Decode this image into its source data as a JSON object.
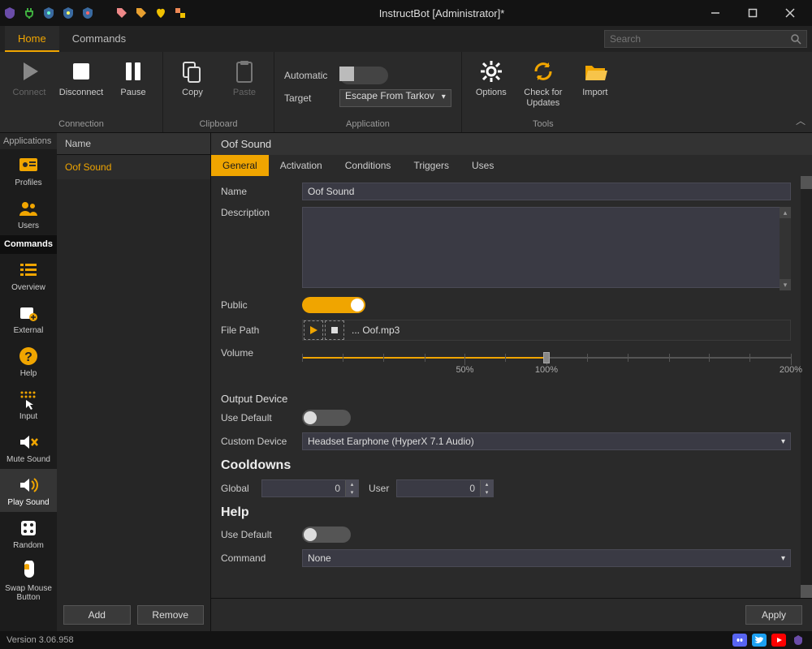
{
  "window": {
    "title": "InstructBot [Administrator]*"
  },
  "menu": {
    "tabs": [
      "Home",
      "Commands"
    ],
    "active": 0,
    "search_placeholder": "Search"
  },
  "ribbon": {
    "connection": {
      "label": "Connection",
      "connect": "Connect",
      "disconnect": "Disconnect",
      "pause": "Pause"
    },
    "clipboard": {
      "label": "Clipboard",
      "copy": "Copy",
      "paste": "Paste"
    },
    "application": {
      "label": "Application",
      "automatic_label": "Automatic",
      "target_label": "Target",
      "target_value": "Escape From Tarkov"
    },
    "tools": {
      "label": "Tools",
      "options": "Options",
      "check_updates": "Check for Updates",
      "import": "Import"
    }
  },
  "apps": {
    "header": "Applications",
    "items": [
      {
        "label": "Profiles"
      },
      {
        "label": "Users"
      },
      {
        "label": "Commands"
      },
      {
        "label": "Overview"
      },
      {
        "label": "External"
      },
      {
        "label": "Help"
      },
      {
        "label": "Input"
      },
      {
        "label": "Mute Sound"
      },
      {
        "label": "Play Sound"
      },
      {
        "label": "Random"
      },
      {
        "label": "Swap Mouse Button"
      }
    ],
    "active": 8
  },
  "list": {
    "column": "Name",
    "items": [
      "Oof Sound"
    ],
    "active": 0,
    "add": "Add",
    "remove": "Remove"
  },
  "editor": {
    "header": "Oof Sound",
    "tabs": [
      "General",
      "Activation",
      "Conditions",
      "Triggers",
      "Uses"
    ],
    "active": 0,
    "name_label": "Name",
    "name_value": "Oof Sound",
    "description_label": "Description",
    "description_value": "",
    "public_label": "Public",
    "public_on": true,
    "filepath_label": "File Path",
    "filepath_value": "...  Oof.mp3",
    "volume_label": "Volume",
    "volume_value": 100,
    "volume_ticks": [
      "50%",
      "100%",
      "200%"
    ],
    "output_device_heading": "Output Device",
    "use_default_label": "Use Default",
    "use_default_on": false,
    "custom_device_label": "Custom Device",
    "custom_device_value": "Headset Earphone (HyperX 7.1 Audio)",
    "cooldowns_heading": "Cooldowns",
    "cooldown_global_label": "Global",
    "cooldown_global_value": "0",
    "cooldown_user_label": "User",
    "cooldown_user_value": "0",
    "help_heading": "Help",
    "help_use_default_label": "Use Default",
    "help_use_default_on": false,
    "command_label": "Command",
    "command_value": "None",
    "apply": "Apply"
  },
  "status": {
    "version": "Version 3.06.958"
  }
}
